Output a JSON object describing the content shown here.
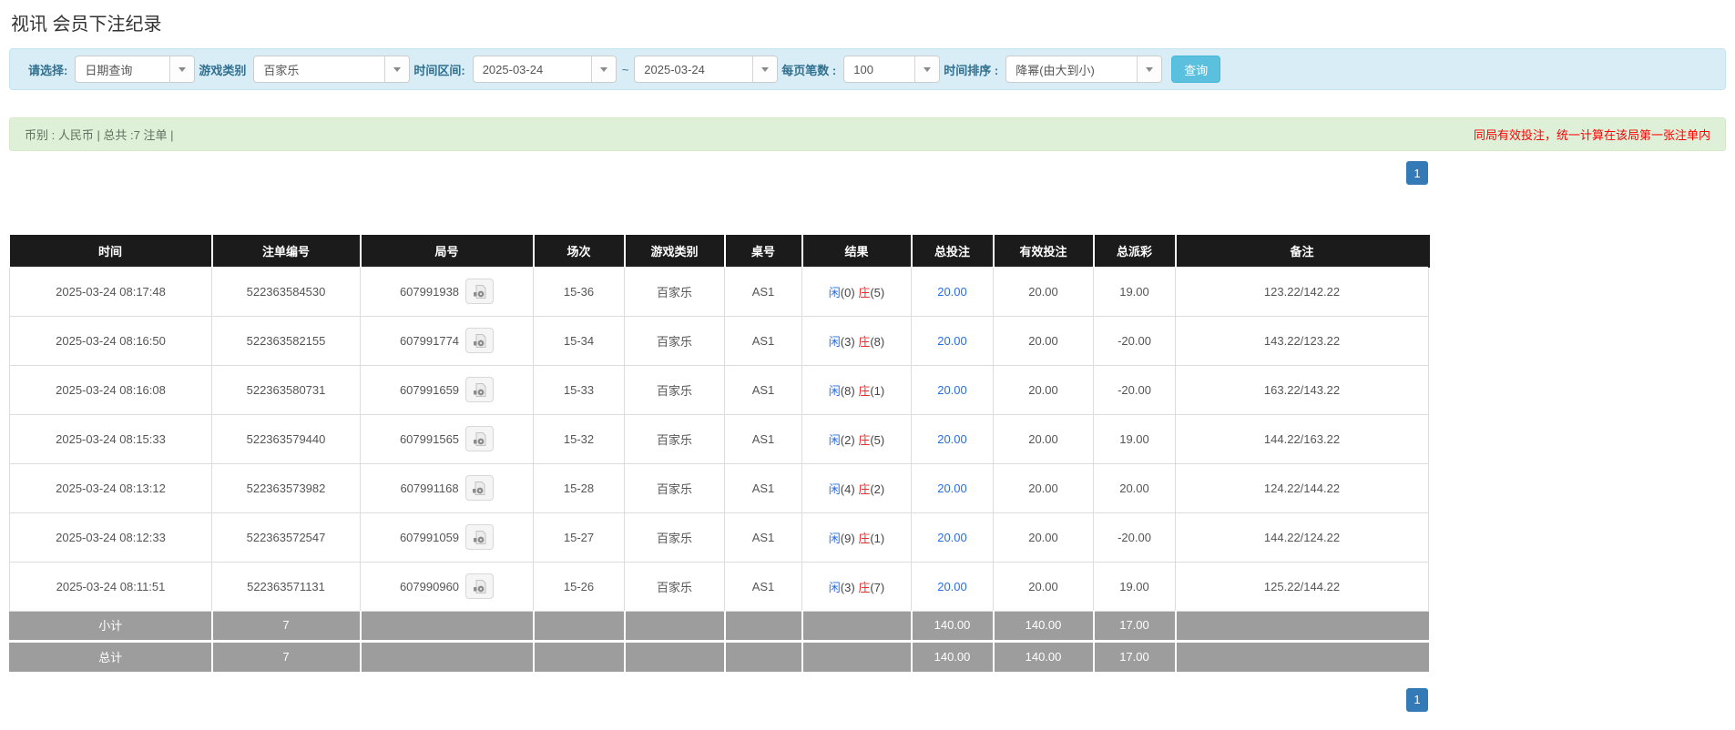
{
  "page": {
    "title": "视讯 会员下注纪录"
  },
  "colors": {
    "filter_bg": "#d9edf7",
    "alert_green_bg": "#dff0d8",
    "query_button_blue": "#5bc0de",
    "pagination_blue": "#337ab7",
    "header_bg": "#1b1b1b",
    "summary_row_gray": "#9d9d9d",
    "link_blue": "#2a6edf",
    "player_blue": "#2a6edf",
    "banker_red": "#e62e2e",
    "negative_red": "#e60000"
  },
  "filters": {
    "select_label": "请选择:",
    "select_value": "日期查询",
    "game_label": "游戏类别",
    "game_value": "百家乐",
    "range_label": "时间区间:",
    "date_from": "2025-03-24",
    "tilde": "~",
    "date_to": "2025-03-24",
    "page_size_label": "每页笔数 :",
    "page_size_value": "100",
    "sort_label": "时间排序 :",
    "sort_value": "降幂(由大到小)",
    "query_button": "查询"
  },
  "summary_bar": {
    "left": "币别 : 人民币 | 总共 :7 注单 |",
    "right": "同局有效投注，统一计算在该局第一张注单内"
  },
  "pagination": {
    "page": "1"
  },
  "table": {
    "headers": [
      "时间",
      "注单编号",
      "局号",
      "场次",
      "游戏类别",
      "桌号",
      "结果",
      "总投注",
      "有效投注",
      "总派彩",
      "备注"
    ],
    "rows": [
      {
        "time": "2025-03-24 08:17:48",
        "bet_id": "522363584530",
        "round_id": "607991938",
        "session": "15-36",
        "game": "百家乐",
        "table_no": "AS1",
        "player": "闲",
        "player_n": "(0)",
        "banker": "庄",
        "banker_n": "(5)",
        "total_bet": "20.00",
        "valid_bet": "20.00",
        "payout": "19.00",
        "remark": "123.22/142.22"
      },
      {
        "time": "2025-03-24 08:16:50",
        "bet_id": "522363582155",
        "round_id": "607991774",
        "session": "15-34",
        "game": "百家乐",
        "table_no": "AS1",
        "player": "闲",
        "player_n": "(3)",
        "banker": "庄",
        "banker_n": "(8)",
        "total_bet": "20.00",
        "valid_bet": "20.00",
        "payout": "-20.00",
        "remark": "143.22/123.22"
      },
      {
        "time": "2025-03-24 08:16:08",
        "bet_id": "522363580731",
        "round_id": "607991659",
        "session": "15-33",
        "game": "百家乐",
        "table_no": "AS1",
        "player": "闲",
        "player_n": "(8)",
        "banker": "庄",
        "banker_n": "(1)",
        "total_bet": "20.00",
        "valid_bet": "20.00",
        "payout": "-20.00",
        "remark": "163.22/143.22"
      },
      {
        "time": "2025-03-24 08:15:33",
        "bet_id": "522363579440",
        "round_id": "607991565",
        "session": "15-32",
        "game": "百家乐",
        "table_no": "AS1",
        "player": "闲",
        "player_n": "(2)",
        "banker": "庄",
        "banker_n": "(5)",
        "total_bet": "20.00",
        "valid_bet": "20.00",
        "payout": "19.00",
        "remark": "144.22/163.22"
      },
      {
        "time": "2025-03-24 08:13:12",
        "bet_id": "522363573982",
        "round_id": "607991168",
        "session": "15-28",
        "game": "百家乐",
        "table_no": "AS1",
        "player": "闲",
        "player_n": "(4)",
        "banker": "庄",
        "banker_n": "(2)",
        "total_bet": "20.00",
        "valid_bet": "20.00",
        "payout": "20.00",
        "remark": "124.22/144.22"
      },
      {
        "time": "2025-03-24 08:12:33",
        "bet_id": "522363572547",
        "round_id": "607991059",
        "session": "15-27",
        "game": "百家乐",
        "table_no": "AS1",
        "player": "闲",
        "player_n": "(9)",
        "banker": "庄",
        "banker_n": "(1)",
        "total_bet": "20.00",
        "valid_bet": "20.00",
        "payout": "-20.00",
        "remark": "144.22/124.22"
      },
      {
        "time": "2025-03-24 08:11:51",
        "bet_id": "522363571131",
        "round_id": "607990960",
        "session": "15-26",
        "game": "百家乐",
        "table_no": "AS1",
        "player": "闲",
        "player_n": "(3)",
        "banker": "庄",
        "banker_n": "(7)",
        "total_bet": "20.00",
        "valid_bet": "20.00",
        "payout": "19.00",
        "remark": "125.22/144.22"
      }
    ],
    "subtotal": {
      "label": "小计",
      "count": "7",
      "total_bet": "140.00",
      "valid_bet": "140.00",
      "payout": "17.00"
    },
    "total": {
      "label": "总计",
      "count": "7",
      "total_bet": "140.00",
      "valid_bet": "140.00",
      "payout": "17.00"
    }
  }
}
